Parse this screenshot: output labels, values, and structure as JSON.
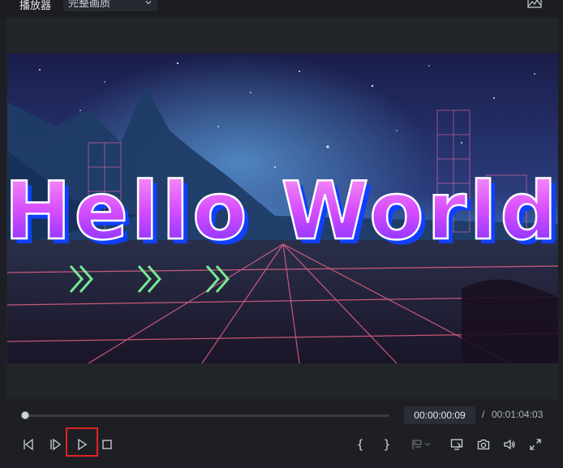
{
  "header": {
    "player_label": "播放器",
    "quality_selected": "完整画质"
  },
  "video": {
    "title_text": "Hello World"
  },
  "playback": {
    "current_time": "00:00:00:09",
    "separator": "/",
    "total_time": "00:01:04:03",
    "progress_fraction": 0.002
  },
  "controls": {
    "left": [
      "prev-frame-icon",
      "next-frame-icon",
      "play-icon",
      "stop-icon"
    ],
    "right": [
      "mark-in-icon",
      "mark-out-icon",
      "marker-icon",
      "monitor-icon",
      "snapshot-icon",
      "volume-icon",
      "fullscreen-icon"
    ],
    "mark_in_label": "{",
    "mark_out_label": "}"
  },
  "colors": {
    "highlight": "#e02424",
    "title_gradient_top": "#ff7cf2",
    "title_gradient_bottom": "#7a2cff",
    "arrow_green": "#7dff9a"
  }
}
